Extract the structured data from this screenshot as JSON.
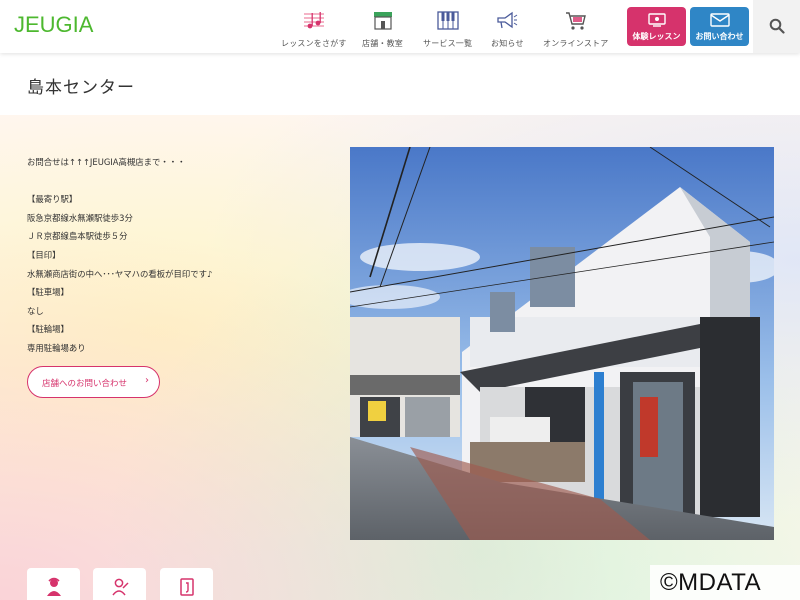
{
  "header": {
    "logo": "JEUGIA",
    "nav": [
      {
        "label": "レッスンをさがす",
        "icon": "music-notes-icon"
      },
      {
        "label": "店舗・教室",
        "icon": "shop-icon"
      },
      {
        "label": "サービス一覧",
        "icon": "piano-keys-icon"
      },
      {
        "label": "お知らせ",
        "icon": "megaphone-icon"
      },
      {
        "label": "オンラインストア",
        "icon": "cart-icon"
      }
    ],
    "trial_label": "体験レッスン",
    "contact_label": "お問い合わせ",
    "search_icon": "search-icon"
  },
  "page": {
    "title": "島本センター"
  },
  "info": {
    "line1": "お問合せは↑↑↑JEUGIA高槻店まで・・・",
    "station_heading": "【最寄り駅】",
    "station1": "阪急京都線水無瀬駅徒歩3分",
    "station2": "ＪＲ京都線島本駅徒歩５分",
    "landmark_heading": "【目印】",
    "landmark": "水無瀬商店街の中へ･･･ヤマハの看板が目印です♪",
    "parking_heading": "【駐車場】",
    "parking": "なし",
    "bike_heading": "【駐輪場】",
    "bike": "専用駐輪場あり"
  },
  "inquiry_button": "店舗へのお問い合わせ",
  "watermark": "©MDATA",
  "colors": {
    "brand_green": "#4db82f",
    "accent_pink": "#d6336c",
    "accent_blue": "#2f86c6"
  }
}
